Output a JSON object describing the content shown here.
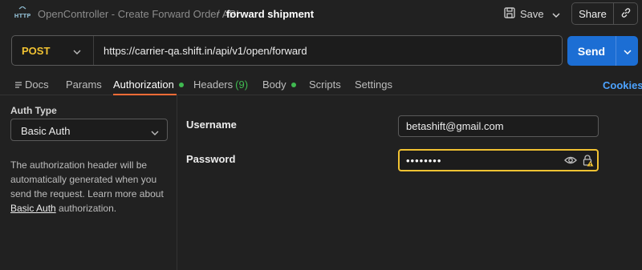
{
  "header": {
    "breadcrumb_parent": "OpenController - Create Forward Order API",
    "breadcrumb_separator": "/",
    "breadcrumb_current": "forward shipment",
    "save_label": "Save",
    "share_label": "Share"
  },
  "request": {
    "method": "POST",
    "url": "https://carrier-qa.shift.in/api/v1/open/forward",
    "send_label": "Send"
  },
  "tabs": [
    {
      "label": "Docs"
    },
    {
      "label": "Params"
    },
    {
      "label": "Authorization",
      "dot": true
    },
    {
      "label": "Headers",
      "count": "(9)"
    },
    {
      "label": "Body",
      "dot": true
    },
    {
      "label": "Scripts"
    },
    {
      "label": "Settings"
    }
  ],
  "cookies_label": "Cookies",
  "auth": {
    "type_label": "Auth Type",
    "type_value": "Basic Auth",
    "description_prefix": "The authorization header will be automatically generated when you send the request. Learn more about",
    "description_link": "Basic Auth",
    "description_suffix": "authorization."
  },
  "fields": {
    "username_label": "Username",
    "username_value": "betashift@gmail.com",
    "password_label": "Password",
    "password_masked": "••••••••"
  },
  "colors": {
    "accent_orange": "#ff6c37",
    "send_blue": "#1c6ed4",
    "method_yellow": "#f1c232",
    "status_green": "#3fb950",
    "link_blue": "#4da3ff"
  }
}
